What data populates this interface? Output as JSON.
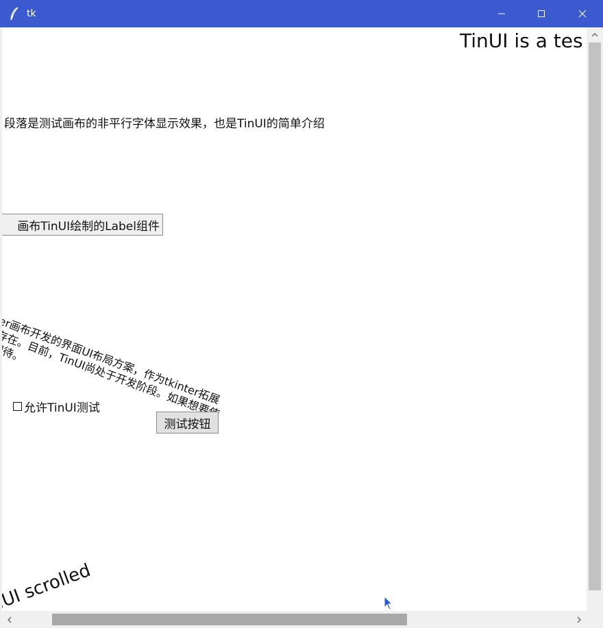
{
  "window": {
    "title": "tk",
    "title_color": "#ffffff",
    "titlebar_color": "#3c5ad0",
    "app_icon": "feather-icon",
    "controls": {
      "minimize_icon": "minimize-icon",
      "maximize_icon": "maximize-icon",
      "close_icon": "close-icon"
    }
  },
  "canvas": {
    "headline": "TinUI is a tes",
    "paragraph": "段落是测试画布的非平行字体显示效果，也是TinUI的简单介绍",
    "label_widget": "画布TinUI绘制的Label组件",
    "rotated_text": {
      "lines": [
        "是基于tkinter画布开发的界面UI布局方案，作为tkinter拓展",
        "ine的拓展而存在。目前，TinUI尚处于开发阶段。如果想要使",
        "TinUI，敬请期待。"
      ]
    },
    "checkbox": {
      "label": "允许TinUI测试",
      "checked": false
    },
    "button": {
      "label": "测试按钮"
    },
    "scrolled_text": "nUI scrolled"
  },
  "scrollbars": {
    "vertical": {
      "up_arrow_icon": "chevron-up-icon",
      "thumb_color": "#c2c2c2"
    },
    "horizontal": {
      "left_arrow_icon": "chevron-left-icon",
      "right_arrow_icon": "chevron-right-icon",
      "thumb_color": "#a8a8a8"
    }
  },
  "cursor_icon": "mouse-pointer-icon"
}
